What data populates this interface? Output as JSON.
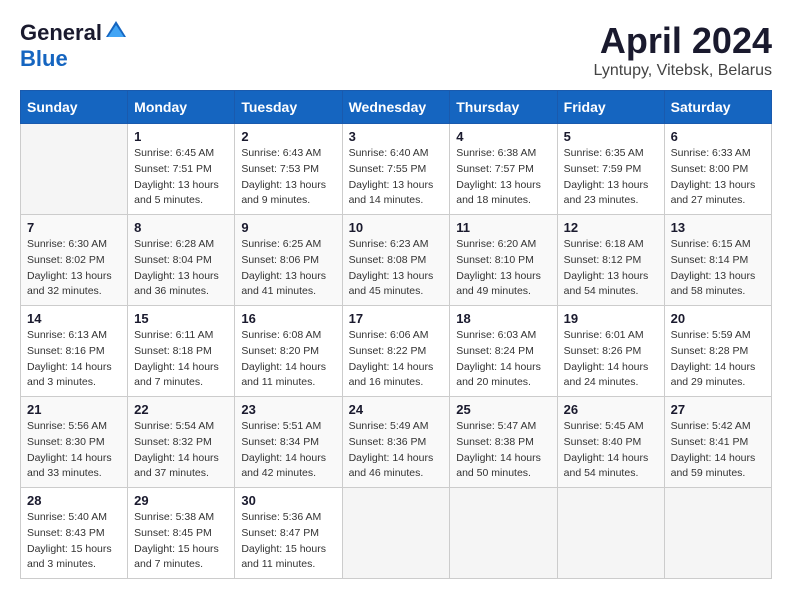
{
  "logo": {
    "general": "General",
    "blue": "Blue"
  },
  "title": "April 2024",
  "location": "Lyntupy, Vitebsk, Belarus",
  "weekdays": [
    "Sunday",
    "Monday",
    "Tuesday",
    "Wednesday",
    "Thursday",
    "Friday",
    "Saturday"
  ],
  "weeks": [
    [
      {
        "day": "",
        "info": ""
      },
      {
        "day": "1",
        "info": "Sunrise: 6:45 AM\nSunset: 7:51 PM\nDaylight: 13 hours\nand 5 minutes."
      },
      {
        "day": "2",
        "info": "Sunrise: 6:43 AM\nSunset: 7:53 PM\nDaylight: 13 hours\nand 9 minutes."
      },
      {
        "day": "3",
        "info": "Sunrise: 6:40 AM\nSunset: 7:55 PM\nDaylight: 13 hours\nand 14 minutes."
      },
      {
        "day": "4",
        "info": "Sunrise: 6:38 AM\nSunset: 7:57 PM\nDaylight: 13 hours\nand 18 minutes."
      },
      {
        "day": "5",
        "info": "Sunrise: 6:35 AM\nSunset: 7:59 PM\nDaylight: 13 hours\nand 23 minutes."
      },
      {
        "day": "6",
        "info": "Sunrise: 6:33 AM\nSunset: 8:00 PM\nDaylight: 13 hours\nand 27 minutes."
      }
    ],
    [
      {
        "day": "7",
        "info": "Sunrise: 6:30 AM\nSunset: 8:02 PM\nDaylight: 13 hours\nand 32 minutes."
      },
      {
        "day": "8",
        "info": "Sunrise: 6:28 AM\nSunset: 8:04 PM\nDaylight: 13 hours\nand 36 minutes."
      },
      {
        "day": "9",
        "info": "Sunrise: 6:25 AM\nSunset: 8:06 PM\nDaylight: 13 hours\nand 41 minutes."
      },
      {
        "day": "10",
        "info": "Sunrise: 6:23 AM\nSunset: 8:08 PM\nDaylight: 13 hours\nand 45 minutes."
      },
      {
        "day": "11",
        "info": "Sunrise: 6:20 AM\nSunset: 8:10 PM\nDaylight: 13 hours\nand 49 minutes."
      },
      {
        "day": "12",
        "info": "Sunrise: 6:18 AM\nSunset: 8:12 PM\nDaylight: 13 hours\nand 54 minutes."
      },
      {
        "day": "13",
        "info": "Sunrise: 6:15 AM\nSunset: 8:14 PM\nDaylight: 13 hours\nand 58 minutes."
      }
    ],
    [
      {
        "day": "14",
        "info": "Sunrise: 6:13 AM\nSunset: 8:16 PM\nDaylight: 14 hours\nand 3 minutes."
      },
      {
        "day": "15",
        "info": "Sunrise: 6:11 AM\nSunset: 8:18 PM\nDaylight: 14 hours\nand 7 minutes."
      },
      {
        "day": "16",
        "info": "Sunrise: 6:08 AM\nSunset: 8:20 PM\nDaylight: 14 hours\nand 11 minutes."
      },
      {
        "day": "17",
        "info": "Sunrise: 6:06 AM\nSunset: 8:22 PM\nDaylight: 14 hours\nand 16 minutes."
      },
      {
        "day": "18",
        "info": "Sunrise: 6:03 AM\nSunset: 8:24 PM\nDaylight: 14 hours\nand 20 minutes."
      },
      {
        "day": "19",
        "info": "Sunrise: 6:01 AM\nSunset: 8:26 PM\nDaylight: 14 hours\nand 24 minutes."
      },
      {
        "day": "20",
        "info": "Sunrise: 5:59 AM\nSunset: 8:28 PM\nDaylight: 14 hours\nand 29 minutes."
      }
    ],
    [
      {
        "day": "21",
        "info": "Sunrise: 5:56 AM\nSunset: 8:30 PM\nDaylight: 14 hours\nand 33 minutes."
      },
      {
        "day": "22",
        "info": "Sunrise: 5:54 AM\nSunset: 8:32 PM\nDaylight: 14 hours\nand 37 minutes."
      },
      {
        "day": "23",
        "info": "Sunrise: 5:51 AM\nSunset: 8:34 PM\nDaylight: 14 hours\nand 42 minutes."
      },
      {
        "day": "24",
        "info": "Sunrise: 5:49 AM\nSunset: 8:36 PM\nDaylight: 14 hours\nand 46 minutes."
      },
      {
        "day": "25",
        "info": "Sunrise: 5:47 AM\nSunset: 8:38 PM\nDaylight: 14 hours\nand 50 minutes."
      },
      {
        "day": "26",
        "info": "Sunrise: 5:45 AM\nSunset: 8:40 PM\nDaylight: 14 hours\nand 54 minutes."
      },
      {
        "day": "27",
        "info": "Sunrise: 5:42 AM\nSunset: 8:41 PM\nDaylight: 14 hours\nand 59 minutes."
      }
    ],
    [
      {
        "day": "28",
        "info": "Sunrise: 5:40 AM\nSunset: 8:43 PM\nDaylight: 15 hours\nand 3 minutes."
      },
      {
        "day": "29",
        "info": "Sunrise: 5:38 AM\nSunset: 8:45 PM\nDaylight: 15 hours\nand 7 minutes."
      },
      {
        "day": "30",
        "info": "Sunrise: 5:36 AM\nSunset: 8:47 PM\nDaylight: 15 hours\nand 11 minutes."
      },
      {
        "day": "",
        "info": ""
      },
      {
        "day": "",
        "info": ""
      },
      {
        "day": "",
        "info": ""
      },
      {
        "day": "",
        "info": ""
      }
    ]
  ]
}
